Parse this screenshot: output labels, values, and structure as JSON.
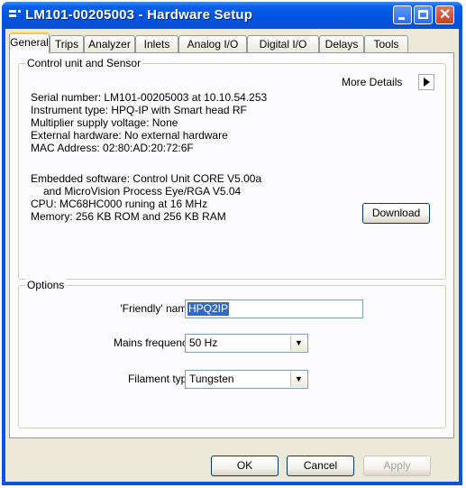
{
  "window": {
    "title": "LM101-00205003 - Hardware Setup"
  },
  "tabs": [
    "General",
    "Trips",
    "Analyzer",
    "Inlets",
    "Analog I/O",
    "Digital I/O",
    "Delays",
    "Tools"
  ],
  "control_unit": {
    "legend": "Control unit and Sensor",
    "more_details_label": "More Details",
    "lines": [
      "Serial number: LM101-00205003 at 10.10.54.253",
      "Instrument type: HPQ-IP with Smart head RF",
      "Multiplier supply voltage: None",
      "External hardware: No external hardware",
      "MAC Address: 02:80:AD:20:72:6F"
    ],
    "software_lines": [
      "Embedded software: Control Unit CORE V5.00a",
      "and MicroVision Process Eye/RGA V5.04",
      "CPU: MC68HC000 runing at 16 MHz",
      "Memory: 256 KB ROM and 256 KB RAM"
    ],
    "download_label": "Download"
  },
  "options": {
    "legend": "Options",
    "friendly_name_label": "'Friendly' name",
    "friendly_name_value": "HPQ2IP",
    "mains_frequency_label": "Mains frequency",
    "mains_frequency_value": "50 Hz",
    "filament_type_label": "Filament type",
    "filament_type_value": "Tungsten"
  },
  "buttons": {
    "ok": "OK",
    "cancel": "Cancel",
    "apply": "Apply"
  }
}
